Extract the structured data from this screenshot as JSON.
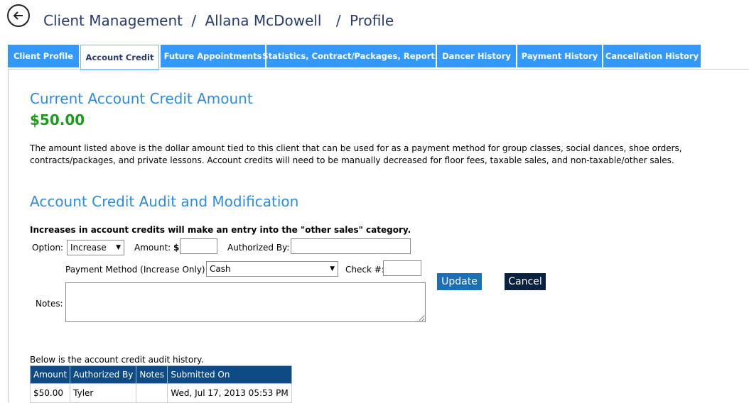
{
  "breadcrumb": {
    "part1": "Client Management",
    "sep1": "/",
    "part2": "Allana McDowell",
    "sep2": "/",
    "part3": "Profile"
  },
  "tabs": [
    {
      "label": "Client Profile",
      "active": false
    },
    {
      "label": "Account Credit",
      "active": true
    },
    {
      "label": "Future Appointments",
      "active": false
    },
    {
      "label": "Statistics, Contract/Packages, Reports",
      "active": false
    },
    {
      "label": "Dancer History",
      "active": false
    },
    {
      "label": "Payment History",
      "active": false
    },
    {
      "label": "Cancellation History",
      "active": false
    }
  ],
  "credit": {
    "heading": "Current Account Credit Amount",
    "amount": "$50.00",
    "description": "The amount listed above is the dollar amount tied to this client that can be used for as a payment method for group classes, social dances, shoe orders, contracts/packages, and private lessons. Account credits will need to be manually decreased for floor fees, taxable sales, and non-taxable/other sales."
  },
  "audit": {
    "heading": "Account Credit Audit and Modification",
    "note": "Increases in account credits will make an entry into the \"other sales\" category.",
    "option_label": "Option:",
    "option_value": "Increase",
    "amount_label": "Amount:",
    "amount_prefix": "$",
    "amount_value": "",
    "authorized_label": "Authorized By:",
    "authorized_value": "",
    "payment_label": "Payment Method (Increase Only):",
    "payment_value": "Cash",
    "check_label": "Check #:",
    "check_value": "",
    "notes_label": "Notes:",
    "notes_value": "",
    "update_label": "Update",
    "cancel_label": "Cancel"
  },
  "history": {
    "caption": "Below is the account credit audit history.",
    "columns": [
      "Amount",
      "Authorized By",
      "Notes",
      "Submitted On"
    ],
    "rows": [
      [
        "$50.00",
        "Tyler",
        "",
        "Wed, Jul 17, 2013 05:53 PM"
      ]
    ]
  },
  "colors": {
    "tab_blue": "#3399ff",
    "heading_blue": "#2e8be0",
    "amount_green": "#1a9e1a",
    "table_header": "#0e4a83",
    "update_button": "#1b6fb5",
    "cancel_button": "#0b2140"
  }
}
